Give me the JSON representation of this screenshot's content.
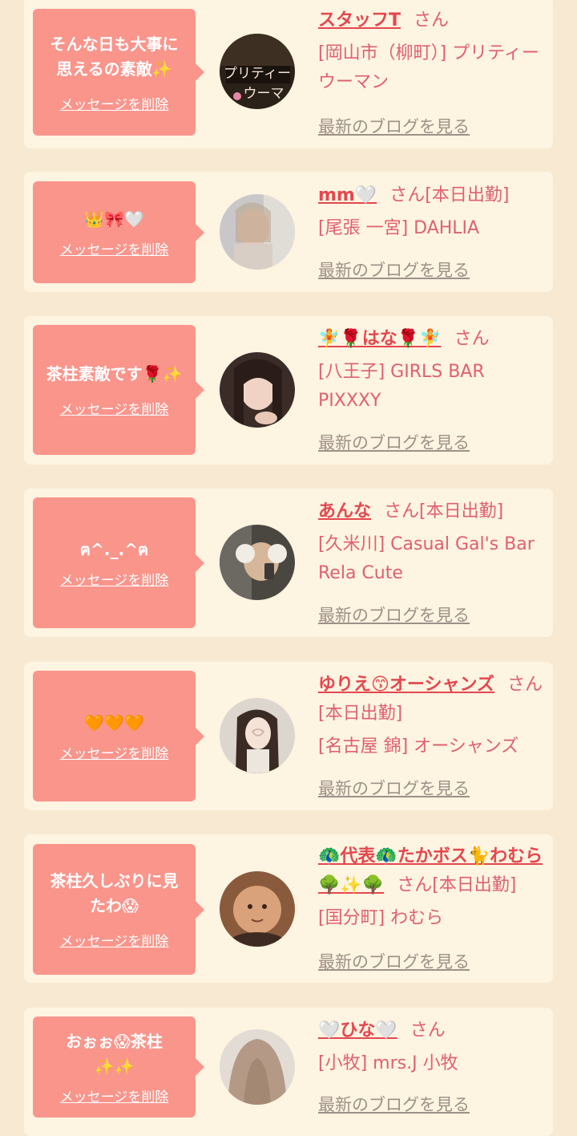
{
  "cards": [
    {
      "message": "そんな日も大事に\n思えるの素敵✨",
      "delete_label": "メッセージを削除",
      "name": "スタッフT",
      "san": "さん",
      "shop": "[岡山市（柳町）] プリティーウーマン",
      "blog_label": "最新のブログを見る",
      "avatar_icon": "book-cover-avatar"
    },
    {
      "message": "👑🎀🤍",
      "delete_label": "メッセージを削除",
      "name": "mm🤍",
      "san": "さん[本日出勤]",
      "shop": "[尾張 一宮] DAHLIA",
      "blog_label": "最新のブログを見る",
      "avatar_icon": "person-photo-avatar"
    },
    {
      "message": "茶柱素敵です🌹✨",
      "delete_label": "メッセージを削除",
      "name": "🧚🌹はな🌹🧚",
      "san": "さん",
      "shop": "[八王子] GIRLS BAR PIXXXY",
      "blog_label": "最新のブログを見る",
      "avatar_icon": "person-photo-avatar"
    },
    {
      "message": "ฅ^._.^ฅ",
      "delete_label": "メッセージを削除",
      "name": "あんな",
      "san": "さん[本日出勤]",
      "shop": "[久米川] Casual Gal's Bar Rela Cute",
      "blog_label": "最新のブログを見る",
      "avatar_icon": "person-photo-avatar"
    },
    {
      "message": "🧡🧡🧡",
      "delete_label": "メッセージを削除",
      "name": "ゆりえ😙オーシャンズ",
      "san": "さん[本日出勤]",
      "shop": "[名古屋 錦] オーシャンズ",
      "blog_label": "最新のブログを見る",
      "avatar_icon": "person-photo-avatar"
    },
    {
      "message": "茶柱久しぶりに見\nたわ😱",
      "delete_label": "メッセージを削除",
      "name": "🦚代表🦚たかボス🐈わむら🌳✨🌳",
      "san": "さん[本日出勤]",
      "shop": "[国分町] わむら",
      "blog_label": "最新のブログを見る",
      "avatar_icon": "face-photo-avatar"
    },
    {
      "message": "おぉぉ😱茶柱\n✨✨",
      "delete_label": "メッセージを削除",
      "name": "🤍ひな🤍",
      "san": "さん",
      "shop": "[小牧] mrs.J 小牧",
      "blog_label": "最新のブログを見る",
      "avatar_icon": "hair-photo-avatar"
    }
  ]
}
